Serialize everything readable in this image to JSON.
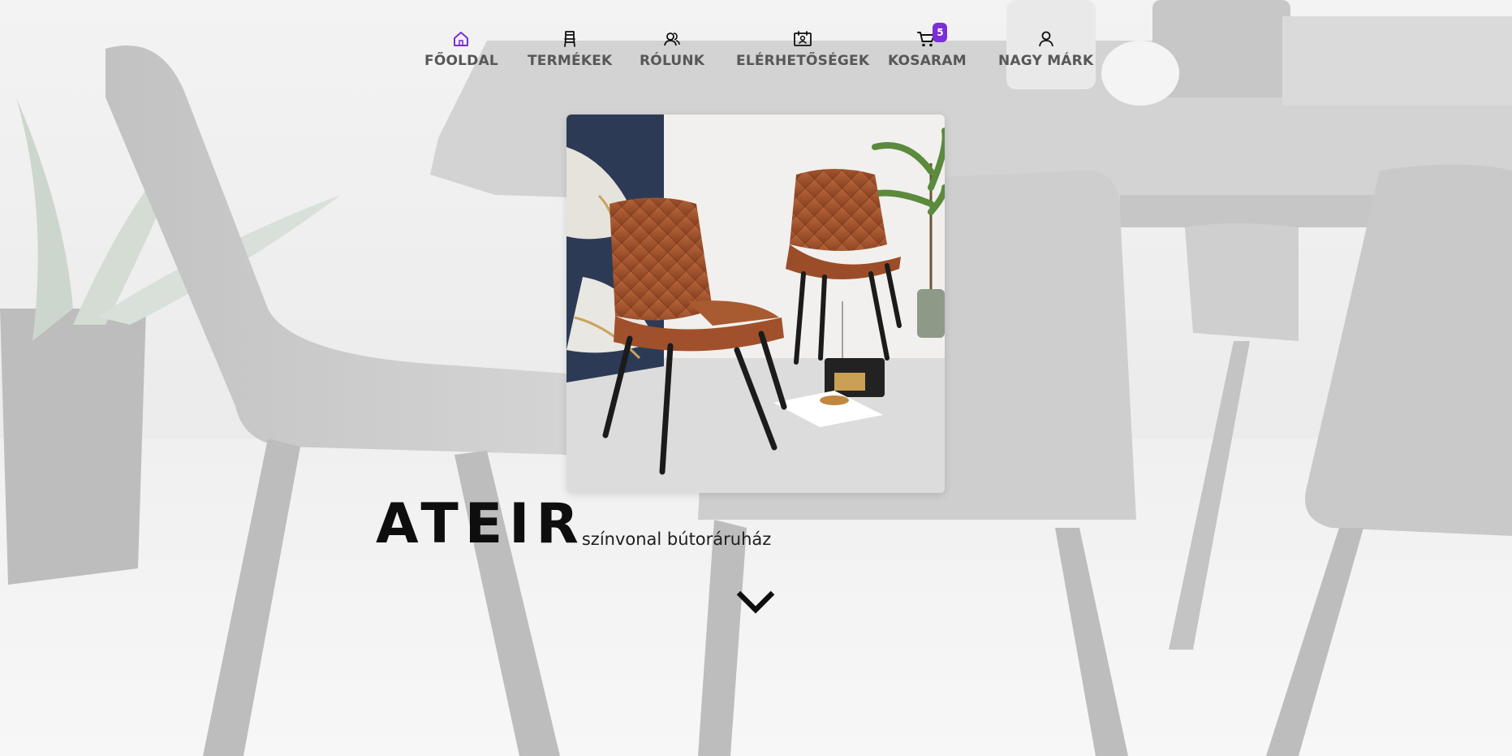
{
  "nav": {
    "items": [
      {
        "label": "FŐOLDAL",
        "icon": "home-icon",
        "active": true
      },
      {
        "label": "TERMÉKEK",
        "icon": "chair-icon"
      },
      {
        "label": "RÓLUNK",
        "icon": "people-icon"
      },
      {
        "label": "ELÉRHETŐSÉGEK",
        "icon": "contact-card-icon"
      },
      {
        "label": "KOSARAM",
        "icon": "cart-icon",
        "badge": "5"
      },
      {
        "label": "NAGY MÁRK",
        "icon": "user-icon"
      }
    ]
  },
  "hero": {
    "brand": "ATEIR",
    "tagline": "színvonal bútoráruház",
    "scroll_icon": "chevron-down-icon"
  },
  "colors": {
    "accent": "#7b2fd6",
    "nav_text": "#575757",
    "brand_text": "#0e0e0e"
  }
}
